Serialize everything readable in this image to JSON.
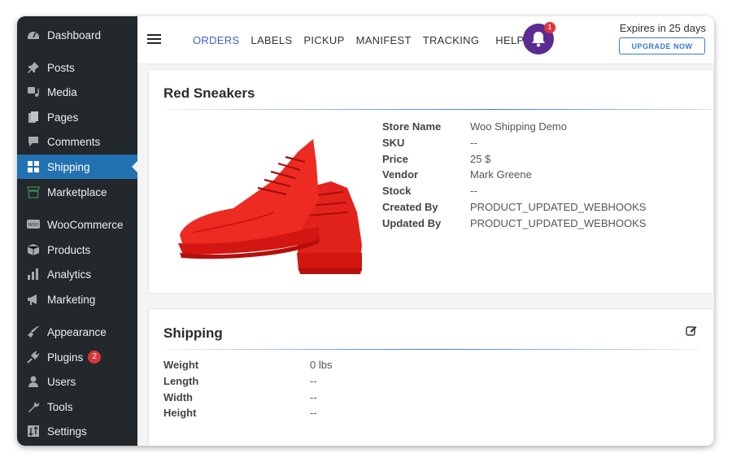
{
  "sidebar": {
    "items": [
      {
        "label": "Dashboard",
        "icon": "dashboard-icon"
      },
      {
        "label": "Posts",
        "icon": "pin-icon"
      },
      {
        "label": "Media",
        "icon": "media-icon"
      },
      {
        "label": "Pages",
        "icon": "pages-icon"
      },
      {
        "label": "Comments",
        "icon": "comment-icon"
      },
      {
        "label": "Shipping",
        "icon": "grid-icon",
        "active": true
      },
      {
        "label": "Marketplace",
        "icon": "store-icon"
      },
      {
        "label": "WooCommerce",
        "icon": "woo-icon"
      },
      {
        "label": "Products",
        "icon": "box-icon"
      },
      {
        "label": "Analytics",
        "icon": "bar-chart-icon"
      },
      {
        "label": "Marketing",
        "icon": "megaphone-icon"
      },
      {
        "label": "Appearance",
        "icon": "brush-icon"
      },
      {
        "label": "Plugins",
        "icon": "plug-icon",
        "badge": "2"
      },
      {
        "label": "Users",
        "icon": "user-icon"
      },
      {
        "label": "Tools",
        "icon": "wrench-icon"
      },
      {
        "label": "Settings",
        "icon": "settings-icon"
      }
    ]
  },
  "topbar": {
    "nav": [
      "ORDERS",
      "LABELS",
      "PICKUP",
      "MANIFEST",
      "TRACKING",
      "HELP"
    ],
    "active_nav": "ORDERS",
    "notification_count": "1",
    "expires_text": "Expires in 25 days",
    "upgrade_label": "UPGRADE NOW",
    "colors": {
      "accent": "#4b5dbd",
      "bell": "#5b2b91",
      "upgrade": "#3a79d6"
    }
  },
  "product": {
    "title": "Red Sneakers",
    "image": "red-sneakers",
    "details": [
      {
        "label": "Store Name",
        "value": "Woo Shipping Demo"
      },
      {
        "label": "SKU",
        "value": "--"
      },
      {
        "label": "Price",
        "value": "25 $"
      },
      {
        "label": "Vendor",
        "value": "Mark Greene"
      },
      {
        "label": "Stock",
        "value": "--"
      },
      {
        "label": "Created By",
        "value": "PRODUCT_UPDATED_WEBHOOKS"
      },
      {
        "label": "Updated By",
        "value": "PRODUCT_UPDATED_WEBHOOKS"
      }
    ]
  },
  "shipping": {
    "title": "Shipping",
    "details": [
      {
        "label": "Weight",
        "value": "0 lbs"
      },
      {
        "label": "Length",
        "value": "--"
      },
      {
        "label": "Width",
        "value": "--"
      },
      {
        "label": "Height",
        "value": "--"
      }
    ]
  }
}
